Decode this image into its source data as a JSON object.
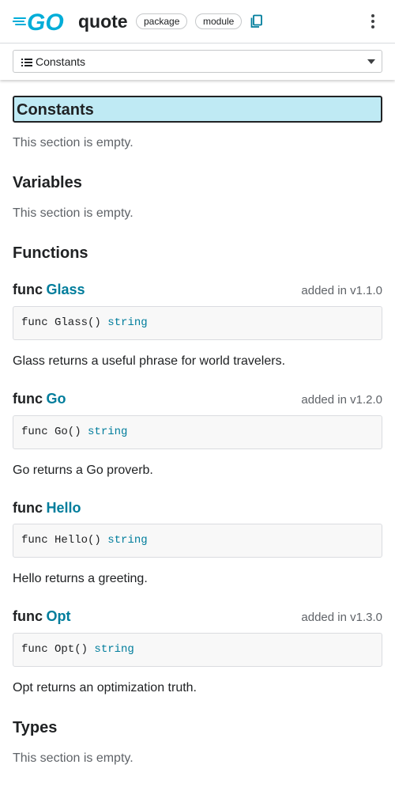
{
  "header": {
    "title": "quote",
    "chips": [
      "package",
      "module"
    ],
    "icons": [
      "go-logo",
      "copy-icon",
      "more-vert-icon"
    ]
  },
  "outline": {
    "selected": "Constants"
  },
  "sections": {
    "constants": {
      "title": "Constants",
      "empty_text": "This section is empty."
    },
    "variables": {
      "title": "Variables",
      "empty_text": "This section is empty."
    },
    "functions": {
      "title": "Functions"
    },
    "types": {
      "title": "Types",
      "empty_text": "This section is empty."
    }
  },
  "functions": [
    {
      "keyword": "func",
      "name": "Glass",
      "added": "added in v1.1.0",
      "sig": "func Glass()",
      "ret": "string",
      "doc": "Glass returns a useful phrase for world travelers."
    },
    {
      "keyword": "func",
      "name": "Go",
      "added": "added in v1.2.0",
      "sig": "func Go()",
      "ret": "string",
      "doc": "Go returns a Go proverb."
    },
    {
      "keyword": "func",
      "name": "Hello",
      "added": "",
      "sig": "func Hello()",
      "ret": "string",
      "doc": "Hello returns a greeting."
    },
    {
      "keyword": "func",
      "name": "Opt",
      "added": "added in v1.3.0",
      "sig": "func Opt()",
      "ret": "string",
      "doc": "Opt returns an optimization truth."
    }
  ],
  "colors": {
    "link": "#007d9c",
    "focus_bg": "#bfeaf4",
    "logo": "#00add8"
  }
}
